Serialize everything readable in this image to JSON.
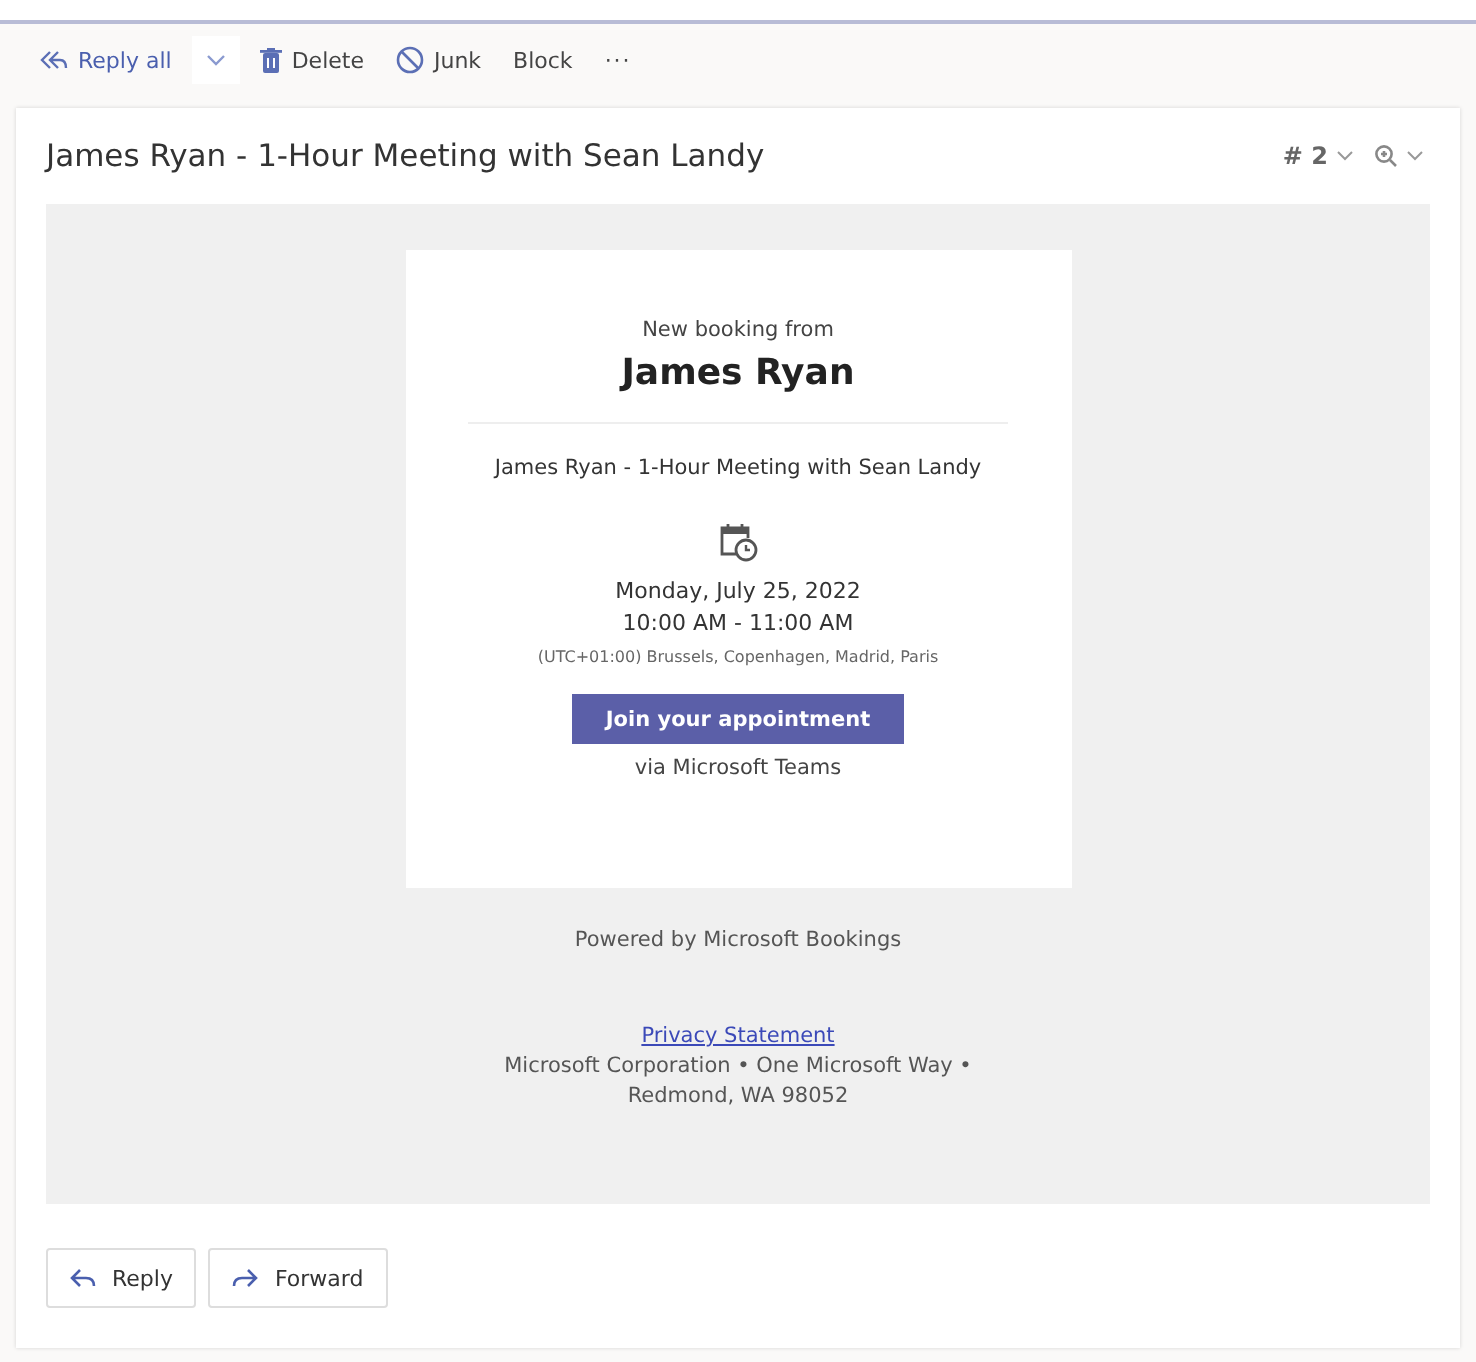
{
  "toolbar": {
    "reply_all": "Reply all",
    "actions": [
      {
        "kind": "delete",
        "label": "Delete"
      },
      {
        "kind": "junk",
        "label": "Junk"
      },
      {
        "kind": "block",
        "label": "Block"
      }
    ],
    "more": "···"
  },
  "message": {
    "subject": "James Ryan - 1-Hour Meeting with Sean Landy",
    "counter_symbol": "#",
    "counter": "2",
    "booking": {
      "intro": "New booking from",
      "customer": "James Ryan",
      "service": "James Ryan - 1-Hour Meeting with Sean Landy",
      "date": "Monday, July 25, 2022",
      "time": "10:00 AM - 11:00 AM",
      "timezone": "(UTC+01:00) Brussels, Copenhagen, Madrid, Paris",
      "join_button": "Join your appointment",
      "via": "via Microsoft Teams"
    },
    "powered_by": "Powered by Microsoft Bookings",
    "privacy_link": "Privacy Statement",
    "address_lines": [
      "Microsoft Corporation • One Microsoft Way •",
      "Redmond, WA 98052"
    ]
  },
  "footer_buttons": [
    {
      "kind": "reply",
      "label": "Reply"
    },
    {
      "kind": "forward",
      "label": "Forward"
    }
  ]
}
